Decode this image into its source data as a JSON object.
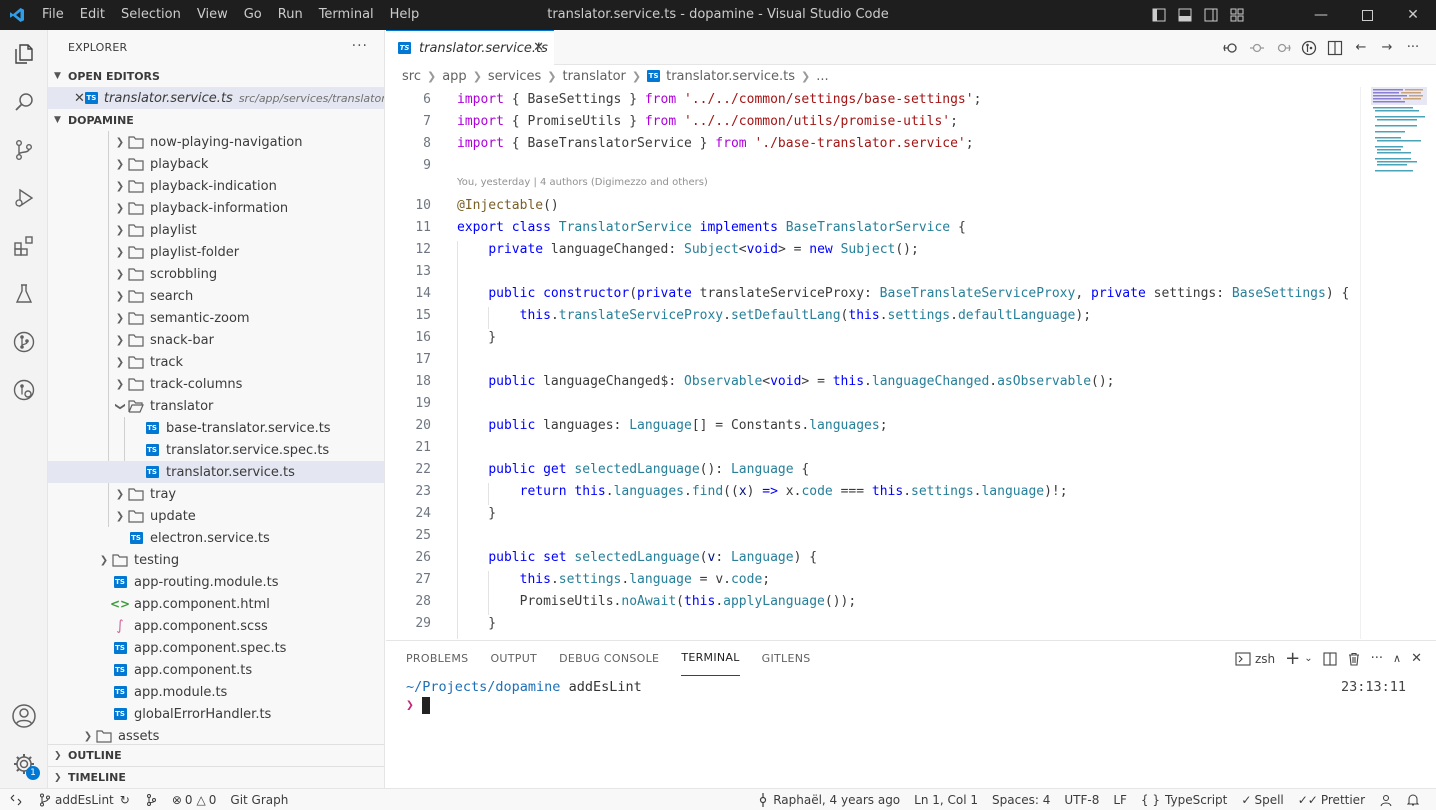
{
  "titlebar": {
    "menu": [
      "File",
      "Edit",
      "Selection",
      "View",
      "Go",
      "Run",
      "Terminal",
      "Help"
    ],
    "title": "translator.service.ts - dopamine - Visual Studio Code"
  },
  "activitybar": {
    "accounts_badge": "1"
  },
  "sidebar": {
    "title": "EXPLORER",
    "open_editors": {
      "label": "OPEN EDITORS",
      "file": "translator.service.ts",
      "path": "src/app/services/translator"
    },
    "workspace": "DOPAMINE",
    "tree": [
      "now-playing-navigation",
      "playback",
      "playback-indication",
      "playback-information",
      "playlist",
      "playlist-folder",
      "scrobbling",
      "search",
      "semantic-zoom",
      "snack-bar",
      "track",
      "track-columns",
      "translator",
      "base-translator.service.ts",
      "translator.service.spec.ts",
      "translator.service.ts",
      "tray",
      "update",
      "electron.service.ts",
      "testing",
      "app-routing.module.ts",
      "app.component.html",
      "app.component.scss",
      "app.component.spec.ts",
      "app.component.ts",
      "app.module.ts",
      "globalErrorHandler.ts",
      "assets"
    ],
    "outline": "OUTLINE",
    "timeline": "TIMELINE"
  },
  "editor": {
    "tab": "translator.service.ts",
    "breadcrumbs": [
      "src",
      "app",
      "services",
      "translator",
      "translator.service.ts",
      "..."
    ],
    "codelens": "You, yesterday | 4 authors (Digimezzo and others)",
    "line_numbers": [
      "6",
      "7",
      "8",
      "9",
      "10",
      "11",
      "12",
      "13",
      "14",
      "15",
      "16",
      "17",
      "18",
      "19",
      "20",
      "21",
      "22",
      "23",
      "24",
      "25",
      "26",
      "27",
      "28",
      "29"
    ],
    "lines": [
      "import { BaseSettings } from '../../common/settings/base-settings';",
      "import { PromiseUtils } from '../../common/utils/promise-utils';",
      "import { BaseTranslatorService } from './base-translator.service';",
      "",
      "@Injectable()",
      "export class TranslatorService implements BaseTranslatorService {",
      "    private languageChanged: Subject<void> = new Subject();",
      "",
      "    public constructor(private translateServiceProxy: BaseTranslateServiceProxy, private settings: BaseSettings) {",
      "        this.translateServiceProxy.setDefaultLang(this.settings.defaultLanguage);",
      "    }",
      "",
      "    public languageChanged$: Observable<void> = this.languageChanged.asObservable();",
      "",
      "    public languages: Language[] = Constants.languages;",
      "",
      "    public get selectedLanguage(): Language {",
      "        return this.languages.find((x) => x.code === this.settings.language)!;",
      "    }",
      "",
      "    public set selectedLanguage(v: Language) {",
      "        this.settings.language = v.code;",
      "        PromiseUtils.noAwait(this.applyLanguage());",
      "    }"
    ]
  },
  "panel": {
    "tabs": [
      "PROBLEMS",
      "OUTPUT",
      "DEBUG CONSOLE",
      "TERMINAL",
      "GITLENS"
    ],
    "active_tab": "TERMINAL",
    "shell": "zsh",
    "cwd": "~/Projects/dopamine",
    "branch": "addEsLint",
    "time": "23:13:11",
    "prompt": "❯"
  },
  "statusbar": {
    "branch": "addEsLint",
    "errors": "0",
    "warnings": "0",
    "git_graph": "Git Graph",
    "blame": "Raphaël, 4 years ago",
    "position": "Ln 1, Col 1",
    "spaces": "Spaces: 4",
    "encoding": "UTF-8",
    "eol": "LF",
    "language": "TypeScript",
    "spell": "Spell",
    "prettier": "Prettier"
  },
  "colors": {
    "accent": "#0078d4",
    "titlebar": "#1e1e1e",
    "keyword": "#0000ff",
    "string": "#a31515",
    "type": "#267f99"
  }
}
